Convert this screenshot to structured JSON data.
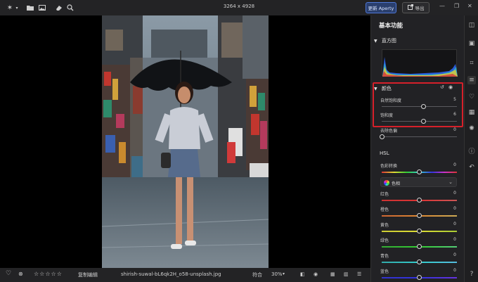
{
  "topbar": {
    "dimensions": "3264 x 4928",
    "update_label": "更新 Aperty",
    "export_label": "导出",
    "icons": [
      "sparkle-icon",
      "folder-icon",
      "image-icon",
      "eraser-icon",
      "magic-icon"
    ]
  },
  "bottombar": {
    "copy_edits": "复制编辑",
    "filename": "shirish-suwal-bL6qk2H_o58-unsplash.jpg",
    "fit": "符合",
    "zoom": "30%",
    "rating": 0
  },
  "panel": {
    "title": "基本功能",
    "histogram_label": "直方图",
    "color_section": "颜色",
    "sliders_color": [
      {
        "label": "自然饱和度",
        "value": "5",
        "pos": 0.56
      },
      {
        "label": "饱和度",
        "value": "6",
        "pos": 0.56
      }
    ],
    "remove_cast": {
      "label": "去除色偏",
      "value": "0",
      "pos": 0.0
    },
    "hsl_label": "HSL",
    "hue_shift": {
      "label": "色彩转换",
      "value": "0",
      "pos": 0.5
    },
    "dropdown_label": "色相",
    "hsl_sliders": [
      {
        "label": "红色",
        "value": "0",
        "pos": 0.5
      },
      {
        "label": "橙色",
        "value": "0",
        "pos": 0.5
      },
      {
        "label": "黄色",
        "value": "0",
        "pos": 0.5
      },
      {
        "label": "绿色",
        "value": "0",
        "pos": 0.5
      },
      {
        "label": "青色",
        "value": "0",
        "pos": 0.5
      },
      {
        "label": "蓝色",
        "value": "0",
        "pos": 0.5
      }
    ]
  },
  "colors": {
    "accent": "#4f78d8",
    "highlight_border": "#d6202a"
  }
}
